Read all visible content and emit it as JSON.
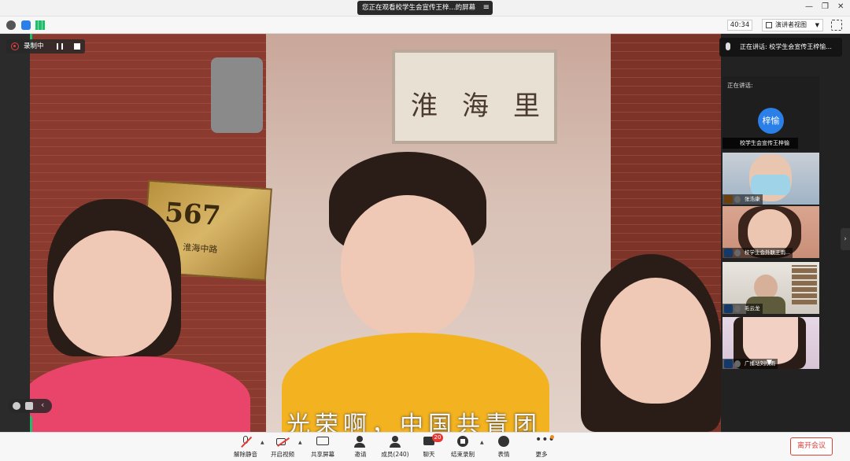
{
  "window": {
    "title": "您正在观看校学生会宣传王梓...的屏幕",
    "menu_icon": "≡"
  },
  "toolbar_top": {
    "timer": "40:34",
    "view_button": "演讲者视图"
  },
  "recording": {
    "label": "录制中"
  },
  "video": {
    "plaque_text": [
      "淮",
      "海",
      "里"
    ],
    "house_number": "567",
    "house_sub": "淮海中路",
    "subtitle": "光荣啊，中国共青团"
  },
  "speaking_banner": "正在讲话: 校学生会宣传王梓愉...",
  "speaker_panel": {
    "label": "正在讲话:",
    "avatar_text": "梓愉",
    "name": "校学生会宣传王梓愉"
  },
  "participants": [
    {
      "name": "张浩康",
      "badge_color": "#f08a1c"
    },
    {
      "name": "校学生会外联王雨...",
      "badge_color": "#2a7fe8"
    },
    {
      "name": "毛云龙",
      "badge_color": "#2a7fe8"
    },
    {
      "name": "广播站刘欣雨",
      "badge_color": "#2a7fe8"
    }
  ],
  "bottom_toolbar": {
    "unmute": "解除静音",
    "start_video": "开启视频",
    "share_screen": "共享屏幕",
    "invite": "邀请",
    "members": "成员(240)",
    "chat": "聊天",
    "chat_badge": "20",
    "stop_recording": "结束录制",
    "reactions": "表情",
    "more": "更多",
    "leave": "离开会议"
  },
  "colors": {
    "accent_blue": "#2a7fe8",
    "record_red": "#e54040",
    "leave_red": "#e0403a",
    "active_green": "#1dbf6a"
  }
}
